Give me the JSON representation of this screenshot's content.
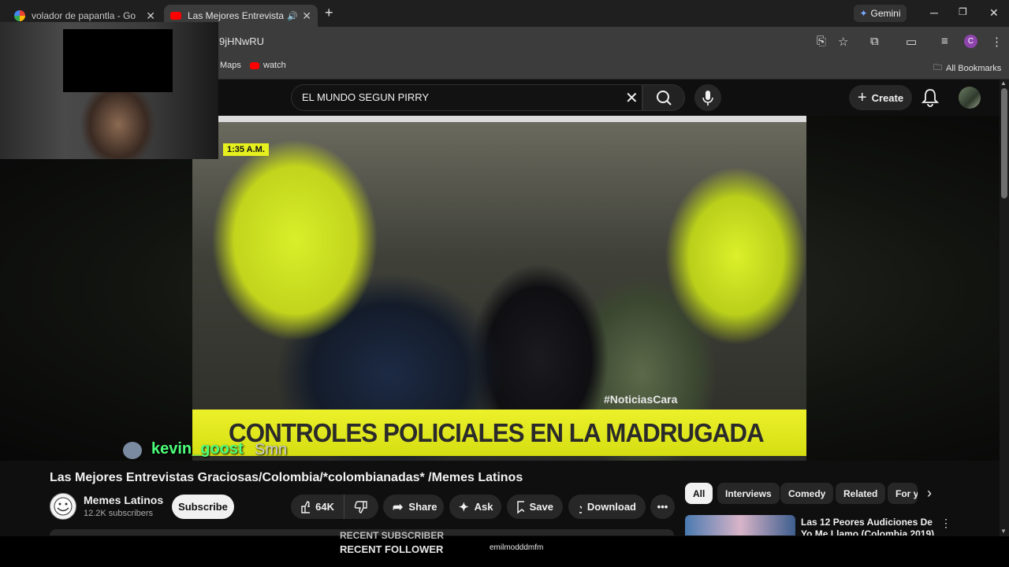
{
  "browser": {
    "tabs": [
      {
        "title": "volador de papantla - Google S"
      },
      {
        "title": "Las Mejores Entrevistas Gra"
      }
    ],
    "url_fragment": "9jHNwRU",
    "gemini_label": "Gemini",
    "profile_initial": "C",
    "bookmarks": [
      {
        "label": "Maps"
      },
      {
        "label": "watch"
      }
    ],
    "all_bookmarks_label": "All Bookmarks"
  },
  "youtube": {
    "search_query": "EL MUNDO SEGUN PIRRY",
    "create_label": "Create",
    "video": {
      "time_tag": "1:35 A.M.",
      "hashtag": "#NoticiasCara",
      "chyron": "CONTROLES POLICIALES EN LA MADRUGADA",
      "title": "Las Mejores Entrevistas Graciosas/Colombia/*colombianadas* /Memes Latinos"
    },
    "channel": {
      "name": "Memes Latinos",
      "subscribers": "12.2K subscribers",
      "subscribe_label": "Subscribe"
    },
    "actions": {
      "likes": "64K",
      "share": "Share",
      "ask": "Ask",
      "save": "Save",
      "download": "Download"
    },
    "chips": [
      "All",
      "Interviews",
      "Comedy",
      "Related",
      "For y"
    ],
    "recommendation": {
      "title": "Las 12 Peores Audiciones De Yo Me Llamo (Colombia 2019)"
    }
  },
  "stream_overlay": {
    "chat_user": "kevin_goost",
    "chat_message": "Smn",
    "recent_subscriber_label": "RECENT SUBSCRIBER",
    "recent_follower_label": "RECENT FOLLOWER",
    "recent_follower_name": "emilmodddmfm"
  },
  "colors": {
    "chyron_yellow": "#e6ee22",
    "chat_green": "#4dff7a",
    "yt_dark": "#0f0f0f"
  }
}
